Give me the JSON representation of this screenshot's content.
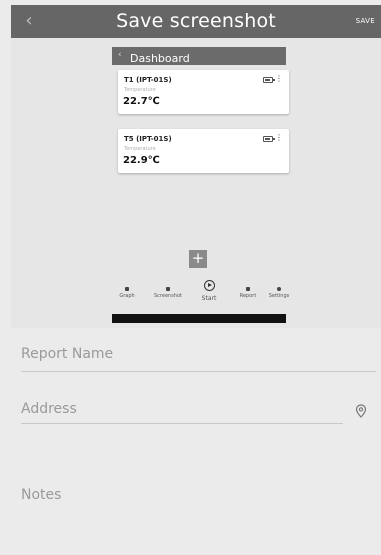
{
  "header": {
    "title": "Save screenshot",
    "save_label": "SAVE",
    "back_glyph": "‹"
  },
  "preview": {
    "nav_title": "Dashboard",
    "cards": [
      {
        "name": "T1 (IPT-01S)",
        "sublabel": "Temperature",
        "value": "22.7℃"
      },
      {
        "name": "T5 (IPT-01S)",
        "sublabel": "Temperature",
        "value": "22.9℃"
      }
    ],
    "add_glyph": "+",
    "tabs": [
      {
        "label": "Graph",
        "icon": "graph-icon"
      },
      {
        "label": "Screenshot",
        "icon": "camera-icon"
      },
      {
        "label": "Start",
        "icon": "play-circle-icon"
      },
      {
        "label": "Report",
        "icon": "report-icon"
      },
      {
        "label": "Settings",
        "icon": "gear-icon"
      }
    ]
  },
  "form": {
    "report_name_placeholder": "Report Name",
    "address_placeholder": "Address",
    "notes_placeholder": "Notes",
    "address_icon": "location-pin-icon"
  }
}
